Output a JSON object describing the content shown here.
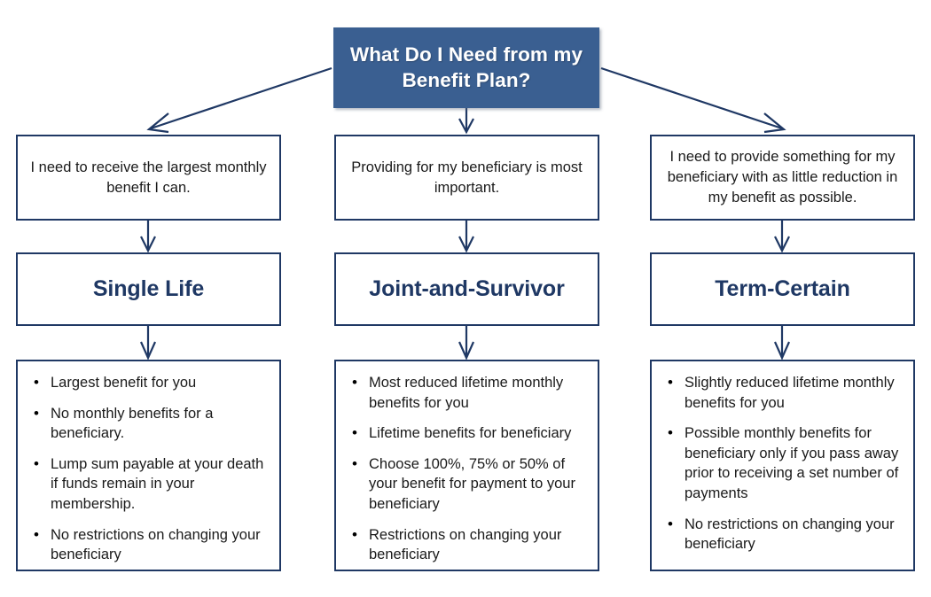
{
  "colors": {
    "title_fill": "#3A5F91",
    "border": "#1F3864",
    "heading_text": "#1F3864",
    "body_text": "#1a1a1a",
    "title_text": "#ffffff",
    "connector": "#1F3864",
    "background": "#ffffff"
  },
  "root": {
    "title": "What Do I Need from my Benefit Plan?"
  },
  "branches": [
    {
      "condition": "I need to receive the largest monthly benefit I can.",
      "plan": "Single Life",
      "details": [
        "Largest benefit for you",
        "No monthly benefits for a beneficiary.",
        "Lump sum payable at your death if funds remain in your membership.",
        "No restrictions on changing your beneficiary"
      ]
    },
    {
      "condition": "Providing for my beneficiary is most important.",
      "plan": "Joint-and-Survivor",
      "details": [
        "Most reduced lifetime monthly benefits for you",
        "Lifetime benefits for beneficiary",
        "Choose 100%, 75% or 50% of your benefit for payment to your beneficiary",
        "Restrictions on changing your beneficiary"
      ]
    },
    {
      "condition": "I need to provide something for my beneficiary with as little reduction in my benefit as possible.",
      "plan": "Term-Certain",
      "details": [
        "Slightly reduced lifetime monthly benefits for you",
        "Possible monthly benefits for beneficiary only if you pass away prior to receiving a set number of payments",
        "No restrictions on changing your beneficiary"
      ]
    }
  ]
}
